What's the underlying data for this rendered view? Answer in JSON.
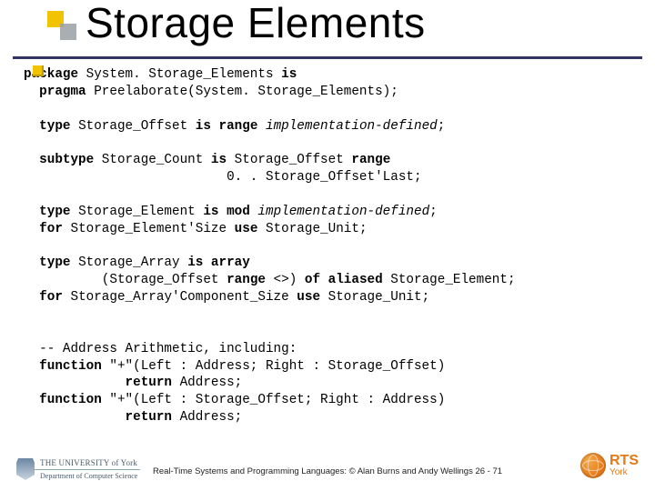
{
  "title": "Storage Elements",
  "code": {
    "l01a": "package ",
    "l01b": "System. Storage_Elements ",
    "l01c": "is",
    "l02a": "  pragma ",
    "l02b": "Preelaborate(System. Storage_Elements);",
    "l03a": "  type ",
    "l03b": "Storage_Offset ",
    "l03c": "is range ",
    "l03d": "implementation-defined",
    "l03e": ";",
    "l04a": "  subtype ",
    "l04b": "Storage_Count ",
    "l04c": "is ",
    "l04d": "Storage_Offset ",
    "l04e": "range",
    "l05": "                          0. . Storage_Offset'Last;",
    "l06a": "  type ",
    "l06b": "Storage_Element ",
    "l06c": "is mod ",
    "l06d": "implementation-defined",
    "l06e": ";",
    "l07a": "  for ",
    "l07b": "Storage_Element'Size ",
    "l07c": "use ",
    "l07d": "Storage_Unit;",
    "l08a": "  type ",
    "l08b": "Storage_Array ",
    "l08c": "is array",
    "l09a": "          (Storage_Offset ",
    "l09b": "range ",
    "l09c": "<>) ",
    "l09d": "of aliased ",
    "l09e": "Storage_Element;",
    "l10a": "  for ",
    "l10b": "Storage_Array'Component_Size ",
    "l10c": "use ",
    "l10d": "Storage_Unit;",
    "l11": "  -- Address Arithmetic, including:",
    "l12a": "  function ",
    "l12b": "\"+\"(Left : Address; Right : Storage_Offset)",
    "l13a": "             return ",
    "l13b": "Address;",
    "l14a": "  function ",
    "l14b": "\"+\"(Left : Storage_Offset; Right : Address)",
    "l15a": "             return ",
    "l15b": "Address;"
  },
  "footer": {
    "univ_top": "THE UNIVERSITY of York",
    "univ_bot": "Department of Computer Science",
    "credit": "Real-Time Systems and Programming Languages: © Alan Burns and Andy Wellings  26 - 71",
    "rts_big": "RTS",
    "rts_small": "York"
  }
}
